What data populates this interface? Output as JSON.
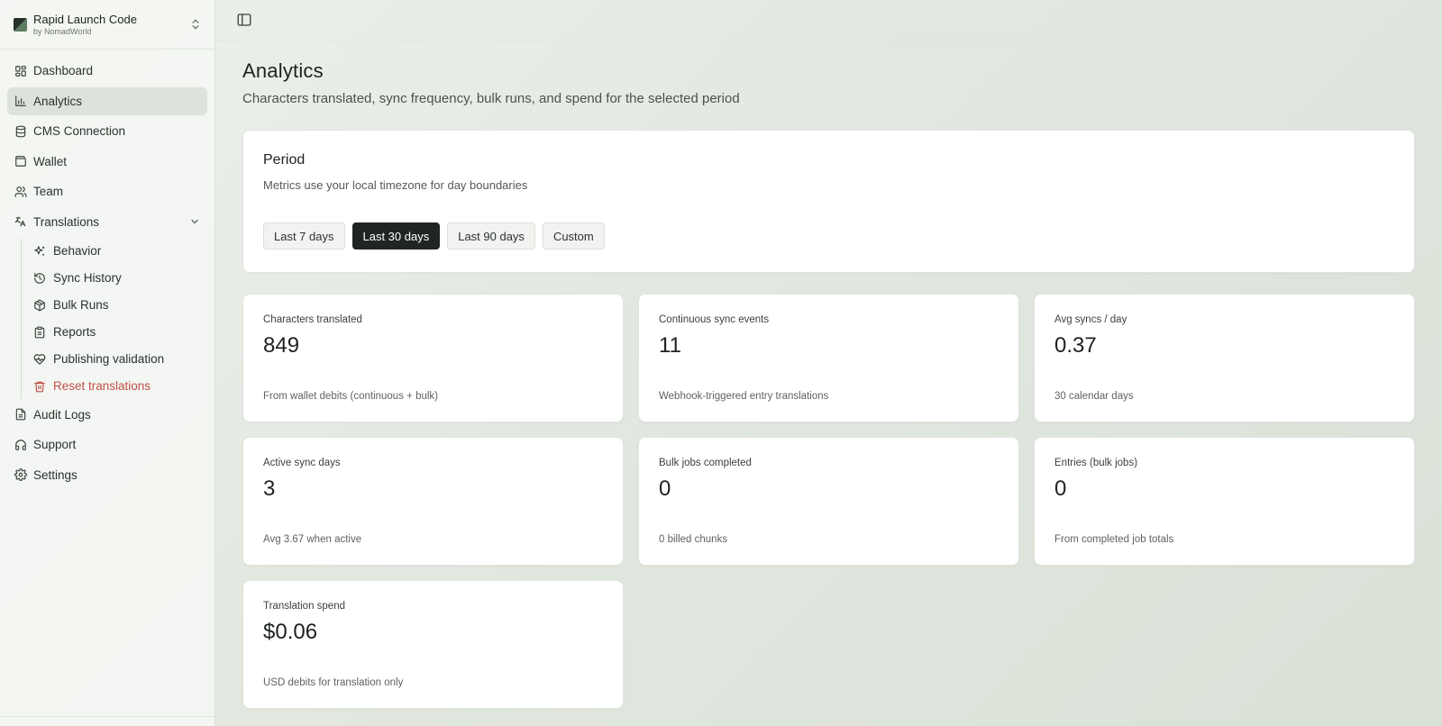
{
  "brand": {
    "name": "Rapid Launch Code",
    "sub": "by NomadWorld"
  },
  "sidebar": {
    "items": [
      {
        "label": "Dashboard",
        "icon": "dashboard-icon"
      },
      {
        "label": "Analytics",
        "icon": "bar-chart-icon",
        "active": true
      },
      {
        "label": "CMS Connection",
        "icon": "database-icon"
      },
      {
        "label": "Wallet",
        "icon": "wallet-icon"
      },
      {
        "label": "Team",
        "icon": "users-icon"
      },
      {
        "label": "Translations",
        "icon": "translate-icon",
        "expanded": true
      }
    ],
    "sub_items": [
      {
        "label": "Behavior",
        "icon": "sparkles-icon"
      },
      {
        "label": "Sync History",
        "icon": "history-icon"
      },
      {
        "label": "Bulk Runs",
        "icon": "package-icon"
      },
      {
        "label": "Reports",
        "icon": "clipboard-icon"
      },
      {
        "label": "Publishing validation",
        "icon": "heart-pulse-icon"
      },
      {
        "label": "Reset translations",
        "icon": "trash-icon",
        "danger": true
      }
    ],
    "bottom_items": [
      {
        "label": "Audit Logs",
        "icon": "file-icon"
      },
      {
        "label": "Support",
        "icon": "headset-icon"
      },
      {
        "label": "Settings",
        "icon": "gear-icon"
      }
    ]
  },
  "page": {
    "title": "Analytics",
    "subtitle": "Characters translated, sync frequency, bulk runs, and spend for the selected period"
  },
  "period": {
    "title": "Period",
    "description": "Metrics use your local timezone for day boundaries",
    "options": [
      "Last 7 days",
      "Last 30 days",
      "Last 90 days",
      "Custom"
    ],
    "selected": "Last 30 days"
  },
  "stats": [
    {
      "label": "Characters translated",
      "value": "849",
      "note": "From wallet debits (continuous + bulk)"
    },
    {
      "label": "Continuous sync events",
      "value": "11",
      "note": "Webhook-triggered entry translations"
    },
    {
      "label": "Avg syncs / day",
      "value": "0.37",
      "note": "30 calendar days"
    },
    {
      "label": "Active sync days",
      "value": "3",
      "note": "Avg 3.67 when active"
    },
    {
      "label": "Bulk jobs completed",
      "value": "0",
      "note": "0 billed chunks"
    },
    {
      "label": "Entries (bulk jobs)",
      "value": "0",
      "note": "From completed job totals"
    },
    {
      "label": "Translation spend",
      "value": "$0.06",
      "note": "USD debits for translation only"
    }
  ],
  "colors": {
    "accent": "#1f2621",
    "danger": "#c0504a",
    "active_nav": "#dde2da"
  }
}
